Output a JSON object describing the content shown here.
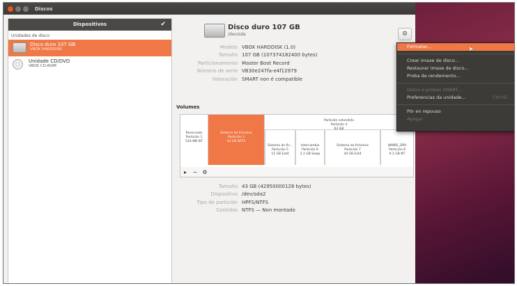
{
  "window": {
    "title": "Discos"
  },
  "sidebar": {
    "header": "Dispositivos",
    "section": "Unidades de disco",
    "drives": [
      {
        "name": "Disco duro 107 GB",
        "sub": "VBOX HARDDISK",
        "selected": true,
        "icon": "hard-disk-icon"
      },
      {
        "name": "Unidade CD/DVD",
        "sub": "VBOX CD-ROM",
        "selected": false,
        "icon": "optical-disc-icon"
      }
    ]
  },
  "disk": {
    "title": "Disco duro 107 GB",
    "subtitle": "/dev/sda",
    "properties": [
      {
        "label": "Modelo",
        "value": "VBOX HARDDISK (1.0)"
      },
      {
        "label": "Tamaño",
        "value": "107 GB (107374182400 bytes)"
      },
      {
        "label": "Particionamento",
        "value": "Master Boot Record"
      },
      {
        "label": "Número de serie",
        "value": "VB30e247fa-e4f12979"
      },
      {
        "label": "Valoración",
        "value": "SMART non é compatible"
      }
    ]
  },
  "volumes": {
    "title": "Volumes",
    "segments": [
      {
        "text": "Reservado\nPartición 1\n524 MB NT"
      },
      {
        "text": "Sistema de ficheiros\nPartición 2\n43 GB NTFS"
      },
      {
        "text": "Partición estendida\nPartición 4\n63 GB"
      },
      {
        "text": "Sistema de fic...\nPartición 5\n11 GB Ext4"
      },
      {
        "text": "Intercambio\nPartición 6\n2.1 GB Swap"
      },
      {
        "text": "Sistema de ficheiros\nPartición 7\n44 GB Ext4"
      },
      {
        "text": "WINRE_DRV\nPartición 8\n6.1 GB NT"
      }
    ],
    "toolbar": [
      "▸",
      "−",
      "⚙"
    ]
  },
  "volume_props": [
    {
      "label": "Tamaño",
      "value": "43 GB (42950000128 bytes)"
    },
    {
      "label": "Dispositivo",
      "value": "/dev/sda2"
    },
    {
      "label": "Tipo de partición",
      "value": "HPFS/NTFS"
    },
    {
      "label": "Contidos",
      "value": "NTFS — Non montado"
    }
  ],
  "menu": {
    "items": [
      {
        "label": "Formatar...",
        "state": "active"
      },
      {
        "label": "Crear imaxe de disco...",
        "state": "normal"
      },
      {
        "label": "Restaurar imaxe de disco...",
        "state": "normal"
      },
      {
        "label": "Proba de rendemento...",
        "state": "normal"
      },
      {
        "label": "Datos e probas SMART...",
        "state": "disabled"
      },
      {
        "label": "Preferencias da unidade...",
        "state": "normal",
        "accel": "Ctrl+E"
      },
      {
        "label": "Pór en repouso",
        "state": "normal"
      },
      {
        "label": "Apagar",
        "state": "disabled"
      }
    ]
  }
}
